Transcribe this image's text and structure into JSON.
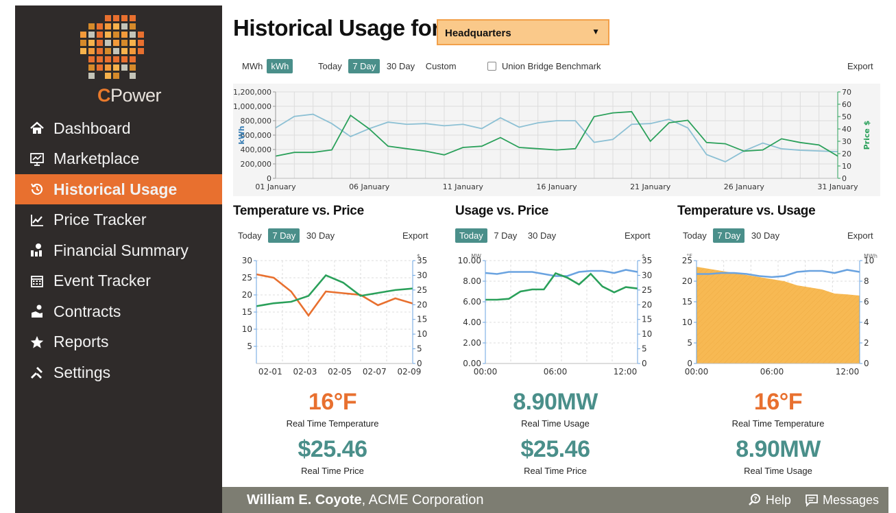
{
  "brand": {
    "logo_text_c": "C",
    "logo_text_rest": "Power"
  },
  "sidebar": {
    "items": [
      {
        "label": "Dashboard",
        "icon": "home-icon",
        "active": false
      },
      {
        "label": "Marketplace",
        "icon": "monitor-chart-icon",
        "active": false
      },
      {
        "label": "Historical Usage",
        "icon": "history-icon",
        "active": true
      },
      {
        "label": "Price Tracker",
        "icon": "line-chart-icon",
        "active": false
      },
      {
        "label": "Financial Summary",
        "icon": "money-bag-icon",
        "active": false
      },
      {
        "label": "Event Tracker",
        "icon": "calendar-icon",
        "active": false
      },
      {
        "label": "Contracts",
        "icon": "contract-icon",
        "active": false
      },
      {
        "label": "Reports",
        "icon": "star-icon",
        "active": false
      },
      {
        "label": "Settings",
        "icon": "tools-icon",
        "active": false
      }
    ],
    "accent": "#e8702f",
    "background": "#2f2b2a"
  },
  "header": {
    "title": "Historical Usage for",
    "site_select": "Headquarters"
  },
  "main_toolbar": {
    "unit_mwh": "MWh",
    "unit_kwh": "kWh",
    "today": "Today",
    "seven_day": "7 Day",
    "thirty_day": "30 Day",
    "custom": "Custom",
    "benchmark_label": "Union Bridge Benchmark",
    "benchmark_checked": false,
    "export": "Export"
  },
  "panels": {
    "temp_price": {
      "title": "Temperature vs. Price",
      "today": "Today",
      "seven_day": "7 Day",
      "thirty_day": "30 Day",
      "export": "Export",
      "selected": "7 Day",
      "value1": "16°F",
      "label1": "Real Time Temperature",
      "value2": "$25.46",
      "label2": "Real Time Price"
    },
    "usage_price": {
      "title": "Usage vs. Price",
      "today": "Today",
      "seven_day": "7 Day",
      "thirty_day": "30 Day",
      "export": "Export",
      "selected": "Today",
      "value1": "8.90MW",
      "label1": "Real Time Usage",
      "value2": "$25.46",
      "label2": "Real Time Price"
    },
    "temp_usage": {
      "title": "Temperature vs. Usage",
      "today": "Today",
      "seven_day": "7 Day",
      "thirty_day": "30 Day",
      "export": "Export",
      "selected": "7 Day",
      "value1": "16°F",
      "label1": "Real Time Temperature",
      "value2": "8.90MW",
      "label2": "Real Time Usage"
    }
  },
  "footer": {
    "user_name": "William E. Coyote",
    "company": ", ACME Corporation",
    "help": "Help",
    "messages": "Messages"
  },
  "colors": {
    "teal": "#4a8f8a",
    "orange": "#e8702f",
    "usage_line": "#8cc0d4",
    "price_line": "#2aa05a",
    "usage_blue": "#6aa3e0",
    "temp_fill": "#f7b54a"
  },
  "chart_data": [
    {
      "type": "line",
      "x_ticks": [
        "01 January",
        "06 January",
        "11 January",
        "16 January",
        "21 January",
        "26 January",
        "31 January"
      ],
      "ylabel": "kWh",
      "y2label": "Price $",
      "ylim": [
        0,
        1200000
      ],
      "y_ticks": [
        "0",
        "200,000",
        "400,000",
        "600,000",
        "800,000",
        "1,000,000",
        "1,200,000"
      ],
      "y2lim": [
        0,
        70
      ],
      "y2_ticks": [
        "0",
        "10",
        "20",
        "30",
        "40",
        "50",
        "60",
        "70"
      ],
      "grid": true,
      "series": [
        {
          "axis": "left",
          "values": [
            700000,
            860000,
            890000,
            760000,
            580000,
            690000,
            780000,
            750000,
            760000,
            730000,
            750000,
            690000,
            840000,
            710000,
            770000,
            800000,
            800000,
            500000,
            540000,
            750000,
            760000,
            820000,
            700000,
            330000,
            230000,
            380000,
            490000,
            410000,
            390000,
            380000,
            370000
          ]
        },
        {
          "axis": "right",
          "values": [
            18,
            21,
            21,
            23,
            51,
            40,
            26,
            24,
            22,
            19,
            25,
            26,
            33,
            25,
            24,
            23,
            24,
            50,
            53,
            54,
            30,
            45,
            47,
            29,
            28,
            22,
            23,
            32,
            29,
            27,
            18
          ]
        }
      ]
    },
    {
      "type": "line",
      "x_ticks": [
        "02-01",
        "02-03",
        "02-05",
        "02-07",
        "02-09"
      ],
      "ylim": [
        0,
        30
      ],
      "y_ticks": [
        "5",
        "10",
        "15",
        "20",
        "25",
        "30"
      ],
      "y2_unit": "$",
      "y2lim": [
        0,
        35
      ],
      "y2_ticks": [
        "0",
        "5",
        "10",
        "15",
        "20",
        "25",
        "30",
        "35"
      ],
      "grid": true,
      "series": [
        {
          "axis": "left",
          "values": [
            26,
            25,
            21,
            14,
            21,
            20.5,
            20,
            17,
            19,
            17.5
          ]
        },
        {
          "axis": "right",
          "values": [
            19.5,
            20.5,
            21,
            23,
            30,
            27.5,
            23,
            24,
            25,
            25.5
          ]
        }
      ]
    },
    {
      "type": "line",
      "x_ticks": [
        "00:00",
        "06:00",
        "12:00"
      ],
      "y_unit": "MW",
      "ylim": [
        0,
        10
      ],
      "y_ticks": [
        "0.00",
        "2.00",
        "4.00",
        "6.00",
        "8.00",
        "10.00"
      ],
      "y2_unit": "$",
      "y2lim": [
        0,
        35
      ],
      "y2_ticks": [
        "0",
        "5",
        "10",
        "15",
        "20",
        "25",
        "30",
        "35"
      ],
      "grid": true,
      "series": [
        {
          "axis": "left",
          "values": [
            8.8,
            8.7,
            8.9,
            8.9,
            8.9,
            8.7,
            8.5,
            8.5,
            8.9,
            9.0,
            9.0,
            8.8,
            9.1,
            8.9
          ]
        },
        {
          "axis": "right",
          "values": [
            21.7,
            21.7,
            22.0,
            24.5,
            25.2,
            25.2,
            30.7,
            29.2,
            26.9,
            30.5,
            26.2,
            24.2,
            26.0,
            25.5
          ]
        }
      ]
    },
    {
      "type": "area",
      "x_ticks": [
        "00:00",
        "06:00",
        "12:00"
      ],
      "y_unit": "°F",
      "ylim": [
        0,
        25
      ],
      "y_ticks": [
        "0",
        "5",
        "10",
        "15",
        "20",
        "25"
      ],
      "y2_unit": "MWh",
      "y2lim": [
        0,
        10
      ],
      "y2_ticks": [
        "0",
        "2",
        "4",
        "6",
        "8",
        "10"
      ],
      "grid": true,
      "series": [
        {
          "axis": "left",
          "values": [
            23.5,
            23,
            22.5,
            22,
            21.5,
            21,
            20.5,
            20,
            19,
            18.5,
            18,
            17,
            16.8,
            16.5
          ]
        },
        {
          "axis": "right",
          "values": [
            8.7,
            8.7,
            8.8,
            8.8,
            8.7,
            8.5,
            8.4,
            8.5,
            8.9,
            9.0,
            9.0,
            8.8,
            9.1,
            8.9
          ]
        }
      ]
    }
  ]
}
